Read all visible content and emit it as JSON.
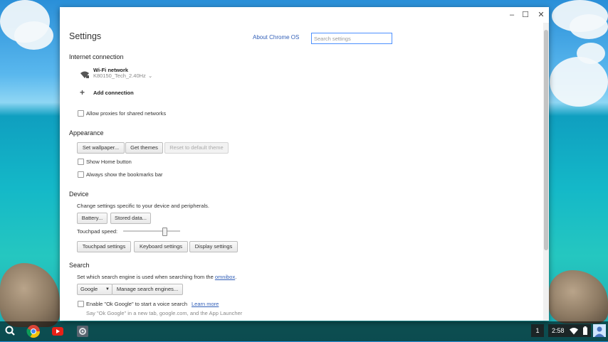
{
  "window": {
    "minimize": "–",
    "maximize": "☐",
    "close": "✕"
  },
  "header": {
    "title": "Settings",
    "about_link": "About Chrome OS",
    "search_placeholder": "Search settings"
  },
  "internet": {
    "title": "Internet connection",
    "wifi_label": "Wi-Fi network",
    "wifi_ssid": "K80150_Tech_2.40Hz",
    "add_connection": "Add connection",
    "allow_proxies": "Allow proxies for shared networks"
  },
  "appearance": {
    "title": "Appearance",
    "set_wallpaper": "Set wallpaper...",
    "get_themes": "Get themes",
    "reset_theme": "Reset to default theme",
    "show_home": "Show Home button",
    "bookmarks_bar": "Always show the bookmarks bar"
  },
  "device": {
    "title": "Device",
    "description": "Change settings specific to your device and peripherals.",
    "battery": "Battery...",
    "stored_data": "Stored data...",
    "touchpad_speed_label": "Touchpad speed:",
    "touchpad_speed_value": 0.72,
    "touchpad_settings": "Touchpad settings",
    "keyboard_settings": "Keyboard settings",
    "display_settings": "Display settings"
  },
  "search": {
    "title": "Search",
    "description_prefix": "Set which search engine is used when searching from the ",
    "omnibox_link": "omnibox",
    "description_suffix": ".",
    "engine_select": "Google",
    "manage_engines": "Manage search engines...",
    "ok_google_label": "Enable \"Ok Google\" to start a voice search",
    "learn_more": "Learn more",
    "ok_google_hint": "Say \"Ok Google\" in a new tab, google.com, and the App Launcher"
  },
  "shelf": {
    "notification_count": "1",
    "time": "2:58"
  }
}
